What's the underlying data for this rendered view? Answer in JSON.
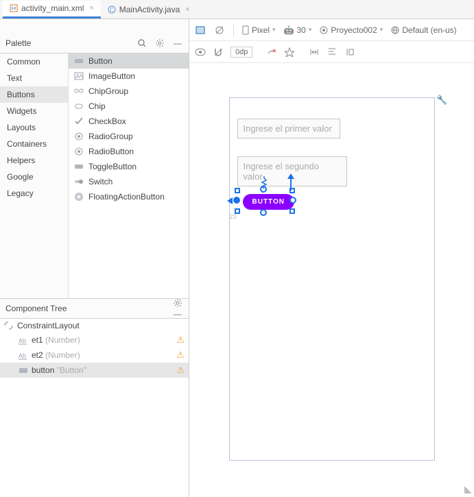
{
  "tabs": [
    {
      "label": "activity_main.xml",
      "active": true,
      "icon": "xml"
    },
    {
      "label": "MainActivity.java",
      "active": false,
      "icon": "java"
    }
  ],
  "palette": {
    "title": "Palette",
    "categories": [
      "Common",
      "Text",
      "Buttons",
      "Widgets",
      "Layouts",
      "Containers",
      "Helpers",
      "Google",
      "Legacy"
    ],
    "selected_category": "Buttons",
    "items": [
      "Button",
      "ImageButton",
      "ChipGroup",
      "Chip",
      "CheckBox",
      "RadioGroup",
      "RadioButton",
      "ToggleButton",
      "Switch",
      "FloatingActionButton"
    ],
    "selected_item": "Button"
  },
  "component_tree": {
    "title": "Component Tree",
    "root": "ConstraintLayout",
    "children": [
      {
        "id": "et1",
        "hint": "(Number)",
        "warn": true
      },
      {
        "id": "et2",
        "hint": "(Number)",
        "warn": true
      },
      {
        "id": "button",
        "hint": "\"Button\"",
        "warn": true,
        "selected": true
      }
    ]
  },
  "design_toolbar": {
    "device": "Pixel",
    "api": "30",
    "project": "Proyecto002",
    "locale": "Default (en-us)",
    "dp": "0dp"
  },
  "canvas": {
    "input1_placeholder": "Ingrese el primer valor",
    "input2_placeholder": "Ingrese el segundo valor",
    "button_text": "BUTTON",
    "guide_x": "23"
  }
}
